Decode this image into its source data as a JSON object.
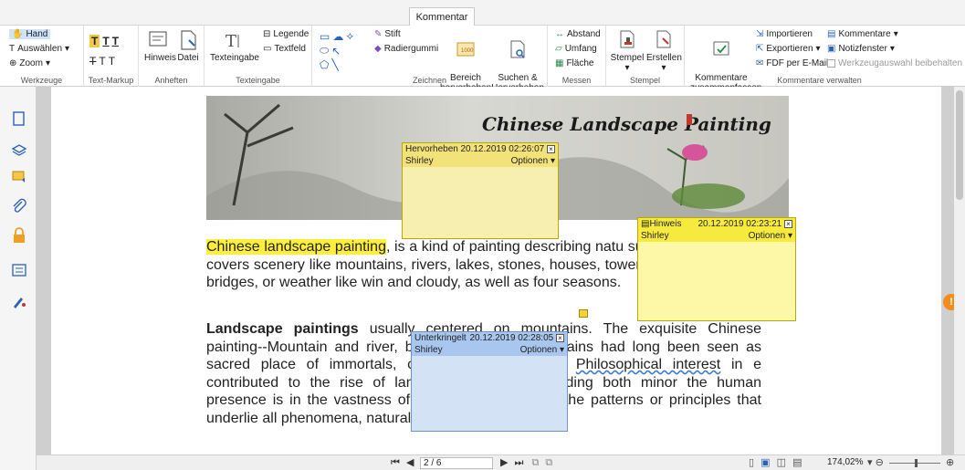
{
  "ribbon": {
    "active_tab": "Kommentar",
    "groups": {
      "werkzeuge": {
        "label": "Werkzeuge",
        "hand": "Hand",
        "auswaehlen": "Auswählen",
        "zoom": "Zoom"
      },
      "textmarkup": {
        "label": "Text-Markup"
      },
      "anheften": {
        "label": "Anheften",
        "hinweis": "Hinweis",
        "datei": "Datei"
      },
      "texteingabe": {
        "label": "Texteingabe",
        "texteingabe": "Texteingabe",
        "legende": "Legende",
        "textfeld": "Textfeld"
      },
      "zeichnen": {
        "label": "Zeichnen",
        "stift": "Stift",
        "radiergummi": "Radiergummi",
        "bereich": "Bereich\nhervorheben",
        "suchen": "Suchen &\nHervorheben"
      },
      "messen": {
        "label": "Messen",
        "abstand": "Abstand",
        "umfang": "Umfang",
        "flaeche": "Fläche"
      },
      "stempel": {
        "label": "Stempel",
        "stempel": "Stempel",
        "erstellen": "Erstellen"
      },
      "verwalten": {
        "label": "Kommentare verwalten",
        "zusammenfassen": "Kommentare\nzusammenfassen",
        "importieren": "Importieren",
        "exportieren": "Exportieren",
        "fdf": "FDF per E-Mail",
        "kommentare": "Kommentare",
        "notizfenster": "Notizfenster",
        "werkzeugauswahl": "Werkzeugauswahl beibehalten"
      }
    }
  },
  "document": {
    "banner_title": "Chinese Landscape Painting",
    "para1": {
      "highlight": "Chinese landscape painting",
      "rest": ", is a kind of painting describing natu subject of landscape covers scenery like mountains, rivers, lakes, stones, houses, towers, pavilions, boats, bridges, or weather like win and cloudy, as well as four seasons."
    },
    "para2": {
      "bold": "Landscape paintings",
      "t1": " usually centered on mountains. The exquisite Chinese painting--Mountain and river, belo",
      "t2": "pe painting. Mountains had long been seen as sacred place",
      "t3": "of immortals, close to the heavens. ",
      "squig": "Philosophical interest",
      "t4": " in",
      "t5": "e contributed to the rise of landscape painting, including both",
      "t6": "minor the human presence is in the vastness of the cosmo",
      "t7": "interest in the patterns or principles that underlie all phenomena, natural and social."
    }
  },
  "notes": [
    {
      "type": "Hervorheben",
      "date": "20.12.2019 02:26:07",
      "author": "Shirley",
      "options": "Optionen",
      "color": "#f7efb0",
      "headcolor": "#f3e27a"
    },
    {
      "type": "Hinweis",
      "date": "20.12.2019 02:23:21",
      "author": "Shirley",
      "options": "Optionen",
      "color": "#fdf8a8",
      "headcolor": "#f6ea3e"
    },
    {
      "type": "Unterkringelt",
      "date": "20.12.2019 02:28:05",
      "author": "Shirley",
      "options": "Optionen",
      "color": "#d4e2f5",
      "headcolor": "#a8c6ee"
    }
  ],
  "status": {
    "page": "2 / 6",
    "zoom": "174,02%"
  }
}
